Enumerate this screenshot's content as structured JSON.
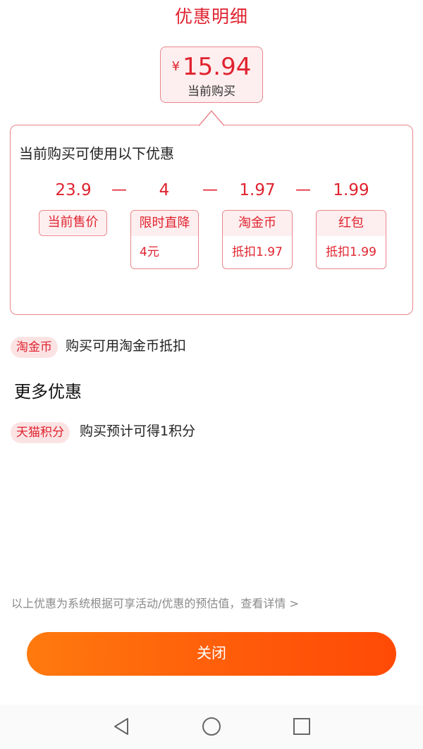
{
  "header": {
    "title": "优惠明细"
  },
  "price": {
    "currency": "¥",
    "amount": "15.94",
    "caption": "当前购买"
  },
  "discount_card": {
    "heading": "当前购买可使用以下优惠",
    "values": [
      "23.9",
      "4",
      "1.97",
      "1.99"
    ],
    "operator": "—",
    "tags": [
      {
        "title": "当前售价"
      },
      {
        "title": "限时直降",
        "detail": "4元"
      },
      {
        "title": "淘金币",
        "detail": "抵扣1.97"
      },
      {
        "title": "红包",
        "detail": "抵扣1.99"
      }
    ]
  },
  "taojinbi_row": {
    "badge": "淘金币",
    "text": "购买可用淘金币抵扣"
  },
  "more": {
    "heading": "更多优惠",
    "tmall_row": {
      "badge": "天猫积分",
      "text": "购买预计可得1积分"
    }
  },
  "footnote": "以上优惠为系统根据可享活动/优惠的预估值，查看详情 >",
  "close_button": {
    "label": "关闭"
  },
  "colors": {
    "accent": "#e0232f",
    "button_start": "#ff7a0e",
    "button_end": "#ff4a06"
  },
  "navbar": {
    "icons": [
      "back-icon",
      "home-icon",
      "recents-icon"
    ]
  }
}
